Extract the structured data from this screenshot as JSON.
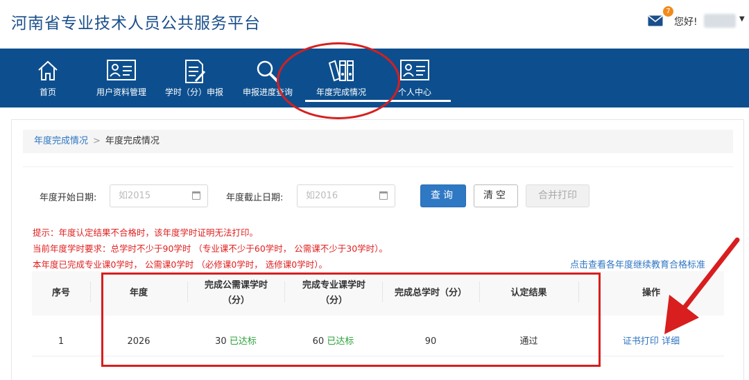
{
  "header": {
    "site_title": "河南省专业技术人员公共服务平台",
    "mail_count": "7",
    "greeting": "您好!",
    "mail_icon": "mail-icon",
    "user_menu_icon": "caret-down-icon"
  },
  "nav": {
    "items": [
      {
        "label": "首页",
        "icon": "home-icon"
      },
      {
        "label": "用户资料管理",
        "icon": "id-card-icon"
      },
      {
        "label": "学时（分）申报",
        "icon": "document-pen-icon"
      },
      {
        "label": "申报进度查询",
        "icon": "magnifier-icon"
      },
      {
        "label": "年度完成情况",
        "icon": "binders-icon"
      },
      {
        "label": "个人中心",
        "icon": "id-card-icon"
      }
    ],
    "active_index": 4
  },
  "breadcrumb": {
    "link": "年度完成情况",
    "separator": ">",
    "current": "年度完成情况"
  },
  "filters": {
    "start_label": "年度开始日期:",
    "start_placeholder": "如2015",
    "end_label": "年度截止日期:",
    "end_placeholder": "如2016",
    "calendar_icon": "calendar-icon"
  },
  "buttons": {
    "query": "查询",
    "clear": "清空",
    "merge_print": "合并打印"
  },
  "notices": {
    "line1": "提示：年度认定结果不合格时，该年度学时证明无法打印。",
    "line2": "当前年度学时要求：总学时不少于90学时 （专业课不少于60学时， 公需课不少于30学时）。",
    "line3": "本年度已完成专业课0学时， 公需课0学时 （必修课0学时， 选修课0学时）。",
    "standard_link": "点击查看各年度继续教育合格标准"
  },
  "table": {
    "headers": {
      "index": "序号",
      "year": "年度",
      "public_hours": "完成公需课学时（分）",
      "pro_hours": "完成专业课学时（分）",
      "total_hours": "完成总学时（分）",
      "result": "认定结果",
      "action": "操作"
    },
    "rows": [
      {
        "index": "1",
        "year": "2026",
        "public_hours": "30",
        "public_status": "已达标",
        "pro_hours": "60",
        "pro_status": "已达标",
        "total_hours": "90",
        "result": "通过",
        "print_link": "证书打印",
        "detail_link": "详细"
      }
    ]
  },
  "colors": {
    "nav_bg": "#0d4f8e",
    "title": "#1a4f8b",
    "link": "#2f76c2",
    "notice": "#e01f1f",
    "ok": "#2aa13a",
    "annotation": "#d81e1e",
    "primary_button": "#2f78c4"
  }
}
